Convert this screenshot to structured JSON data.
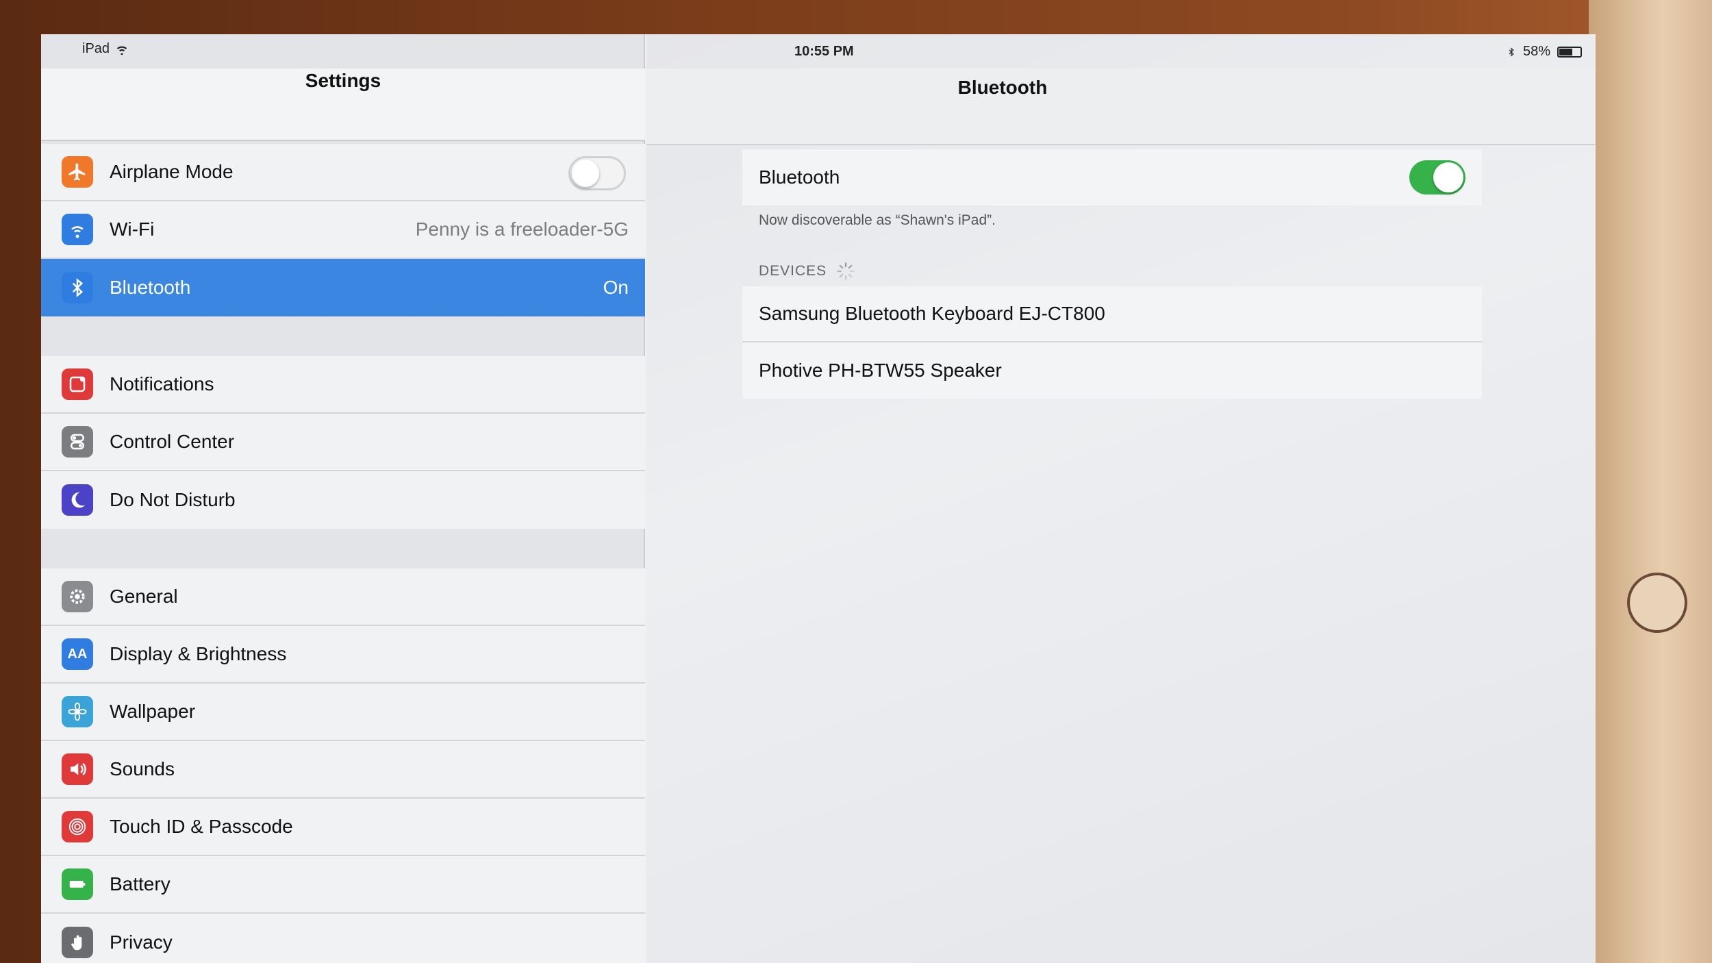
{
  "status_bar": {
    "device": "iPad",
    "time": "10:55 PM",
    "battery": "58%"
  },
  "left": {
    "title": "Settings",
    "group1": [
      {
        "label": "Airplane Mode",
        "icon": "airplane-icon",
        "color": "#f0782a"
      },
      {
        "label": "Wi-Fi",
        "icon": "wifi-icon",
        "color": "#2f7de0",
        "detail": "Penny is a freeloader-5G"
      },
      {
        "label": "Bluetooth",
        "icon": "bluetooth-icon",
        "color": "#2f7de0",
        "detail": "On",
        "selected": true
      }
    ],
    "group2": [
      {
        "label": "Notifications",
        "icon": "notifications-icon",
        "color": "#e0393a"
      },
      {
        "label": "Control Center",
        "icon": "control-center-icon",
        "color": "#7b7d80"
      },
      {
        "label": "Do Not Disturb",
        "icon": "moon-icon",
        "color": "#4b42c8"
      }
    ],
    "group3": [
      {
        "label": "General",
        "icon": "gear-icon",
        "color": "#8a8c90"
      },
      {
        "label": "Display & Brightness",
        "icon": "display-icon",
        "color": "#2f7de0"
      },
      {
        "label": "Wallpaper",
        "icon": "wallpaper-icon",
        "color": "#3aa3d8"
      },
      {
        "label": "Sounds",
        "icon": "speaker-icon",
        "color": "#e0393a"
      },
      {
        "label": "Touch ID & Passcode",
        "icon": "fingerprint-icon",
        "color": "#e0393a"
      },
      {
        "label": "Battery",
        "icon": "battery-icon",
        "color": "#35b34a"
      },
      {
        "label": "Privacy",
        "icon": "hand-icon",
        "color": "#6a6c70"
      }
    ]
  },
  "right": {
    "title": "Bluetooth",
    "toggle_label": "Bluetooth",
    "toggle_on": true,
    "discoverable_note": "Now discoverable as “Shawn's iPad”.",
    "devices_header": "DEVICES",
    "devices": [
      "Samsung Bluetooth Keyboard EJ-CT800",
      "Photive PH-BTW55 Speaker"
    ]
  },
  "colors": {
    "selection": "#3a86e0",
    "toggle_on": "#35b34a"
  }
}
